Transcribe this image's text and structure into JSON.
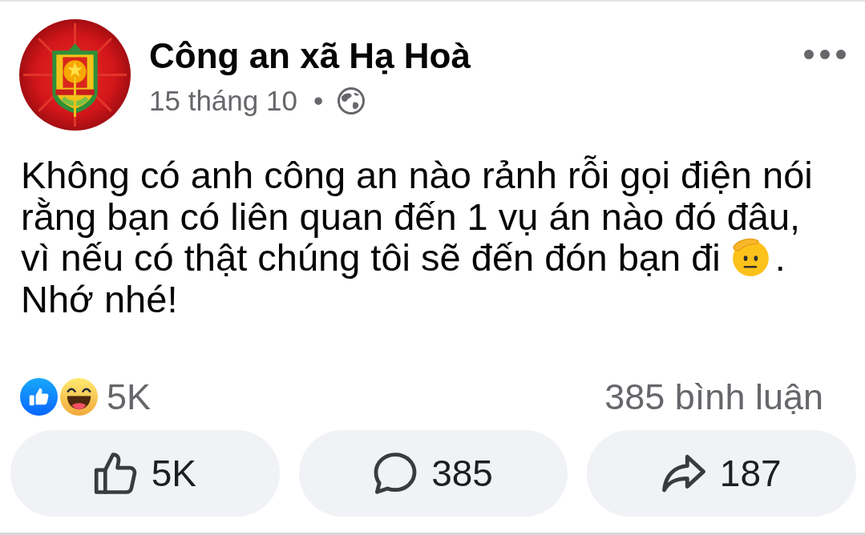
{
  "post": {
    "author": "Công an xã Hạ Hoà",
    "date": "15 tháng 10",
    "separator": "•"
  },
  "body": {
    "lines": [
      "Không có anh công an nào rảnh rỗi gọi điện nói",
      "rằng bạn có liên quan đến 1 vụ án nào đó đâu,",
      "vì nếu có thật chúng tôi sẽ đến đón bạn đi"
    ],
    "after_emoji": ".",
    "last_line": "Nhớ nhé!"
  },
  "summary": {
    "reaction_count": "5K",
    "comment_count": "385 bình luận"
  },
  "actions": [
    {
      "kind": "like",
      "label": "5K"
    },
    {
      "kind": "comment",
      "label": "385"
    },
    {
      "kind": "share",
      "label": "187"
    }
  ]
}
